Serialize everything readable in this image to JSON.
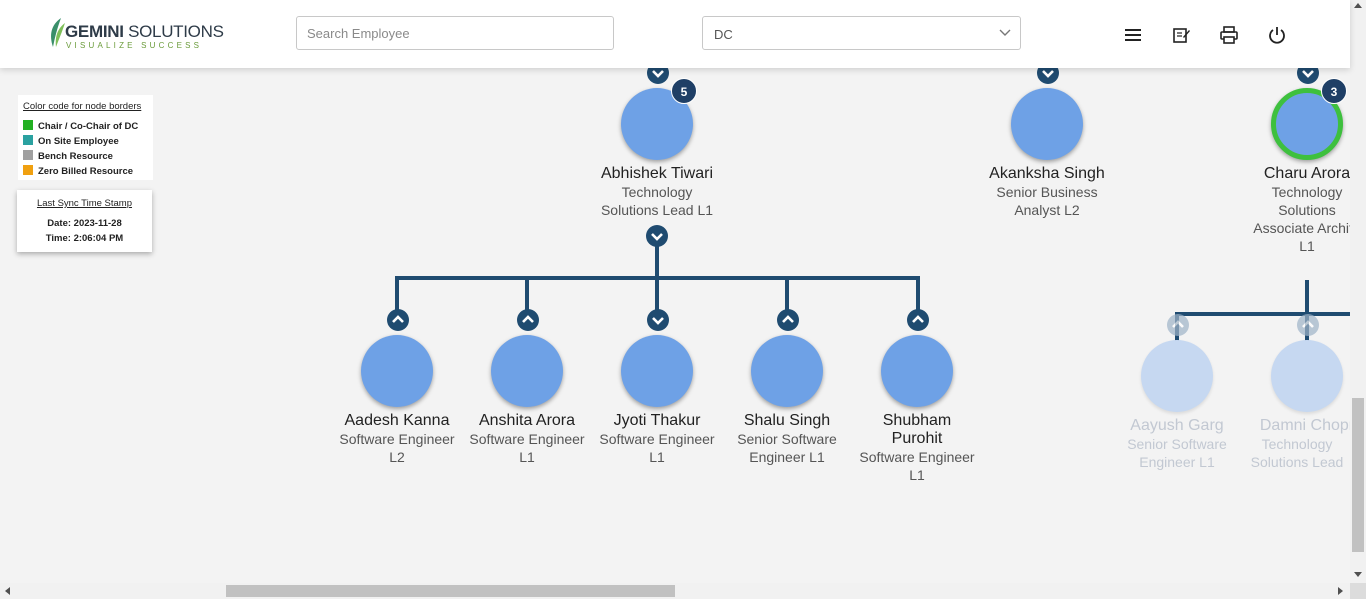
{
  "header": {
    "logo": {
      "brand_bold": "GEMINI",
      "brand_light": " SOLUTIONS",
      "tagline": "VISUALIZE SUCCESS"
    },
    "search": {
      "placeholder": "Search Employee",
      "value": ""
    },
    "department_select": {
      "selected": "DC"
    },
    "icons": [
      "menu-icon",
      "notes-icon",
      "print-icon",
      "power-icon"
    ]
  },
  "legend": {
    "title": "Color code for node borders",
    "items": [
      {
        "label": "Chair / Co-Chair of DC",
        "color": "#22b022"
      },
      {
        "label": "On Site Employee",
        "color": "#2aa1a0"
      },
      {
        "label": "Bench Resource",
        "color": "#a0a0a0"
      },
      {
        "label": "Zero Billed Resource",
        "color": "#f0a010"
      }
    ]
  },
  "sync": {
    "title": "Last Sync Time Stamp",
    "date": "Date: 2023-11-28",
    "time": "Time: 2:06:04 PM"
  },
  "org": {
    "top_nodes": [
      {
        "name": "Abhishek Tiwari",
        "title_lines": [
          "Technology",
          "Solutions Lead L1"
        ],
        "badge": "5"
      },
      {
        "name": "Akanksha Singh",
        "title_lines": [
          "Senior Business",
          "Analyst L2"
        ]
      },
      {
        "name": "Charu Arora",
        "title_lines": [
          "Technology",
          "Solutions",
          "Associate Archite",
          "L1"
        ],
        "badge": "3",
        "border": "chair"
      }
    ],
    "children": [
      {
        "name": "Aadesh Kanna",
        "title_lines": [
          "Software Engineer",
          "L2"
        ]
      },
      {
        "name": "Anshita Arora",
        "title_lines": [
          "Software Engineer",
          "L1"
        ]
      },
      {
        "name": "Jyoti Thakur",
        "title_lines": [
          "Software Engineer",
          "L1"
        ]
      },
      {
        "name": "Shalu Singh",
        "title_lines": [
          "Senior Software",
          "Engineer L1"
        ]
      },
      {
        "name": "Shubham Purohit",
        "name_lines": [
          "Shubham",
          "Purohit"
        ],
        "title_lines": [
          "Software Engineer",
          "L1"
        ]
      }
    ],
    "faded_children": [
      {
        "name": "Aayush Garg",
        "title_lines": [
          "Senior Software",
          "Engineer L1"
        ]
      },
      {
        "name": "Damni Chopr",
        "title_lines": [
          "Technology",
          "Solutions Lead"
        ]
      }
    ]
  }
}
